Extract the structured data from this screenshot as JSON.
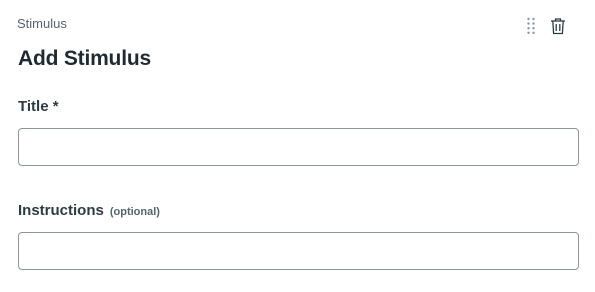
{
  "panel": {
    "section_label": "Stimulus",
    "heading": "Add Stimulus"
  },
  "icons": {
    "drag": "drag-handle-icon",
    "delete": "trash-icon"
  },
  "fields": {
    "title": {
      "label": "Title *",
      "value": "",
      "placeholder": ""
    },
    "instructions": {
      "label": "Instructions",
      "optional_note": "(optional)",
      "value": "",
      "placeholder": ""
    }
  },
  "colors": {
    "text": "#2d3b45",
    "muted": "#57646e",
    "border": "#8b969e"
  }
}
